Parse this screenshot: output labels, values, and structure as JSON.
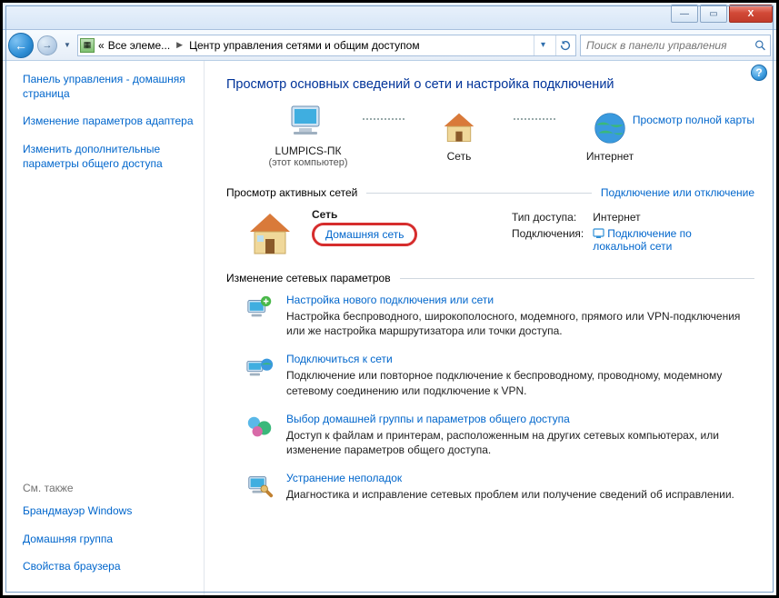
{
  "titlebar": {
    "minimize": "—",
    "maximize": "▭",
    "close": "X"
  },
  "nav": {
    "back_glyph": "←",
    "fwd_glyph": "→",
    "crumb_prefix": "«",
    "crumb1": "Все элеме...",
    "crumb2": "Центр управления сетями и общим доступом",
    "search_placeholder": "Поиск в панели управления"
  },
  "sidebar": {
    "links": [
      "Панель управления - домашняя страница",
      "Изменение параметров адаптера",
      "Изменить дополнительные параметры общего доступа"
    ],
    "see_also_label": "См. также",
    "see_also": [
      "Брандмауэр Windows",
      "Домашняя группа",
      "Свойства браузера"
    ]
  },
  "main": {
    "heading": "Просмотр основных сведений о сети и настройка подключений",
    "map_link": "Просмотр полной карты",
    "topo": {
      "node1": "LUMPICS-ПК",
      "node1_sub": "(этот компьютер)",
      "node2": "Сеть",
      "node3": "Интернет"
    },
    "active_label": "Просмотр активных сетей",
    "active_right": "Подключение или отключение",
    "network": {
      "name": "Сеть",
      "type": "Домашняя сеть",
      "access_label": "Тип доступа:",
      "access_value": "Интернет",
      "conn_label": "Подключения:",
      "conn_value": "Подключение по локальной сети"
    },
    "change_label": "Изменение сетевых параметров",
    "items": [
      {
        "title": "Настройка нового подключения или сети",
        "desc": "Настройка беспроводного, широкополосного, модемного, прямого или VPN-подключения или же настройка маршрутизатора или точки доступа."
      },
      {
        "title": "Подключиться к сети",
        "desc": "Подключение или повторное подключение к беспроводному, проводному, модемному сетевому соединению или подключение к VPN."
      },
      {
        "title": "Выбор домашней группы и параметров общего доступа",
        "desc": "Доступ к файлам и принтерам, расположенным на других сетевых компьютерах, или изменение параметров общего доступа."
      },
      {
        "title": "Устранение неполадок",
        "desc": "Диагностика и исправление сетевых проблем или получение сведений об исправлении."
      }
    ]
  },
  "help_glyph": "?"
}
